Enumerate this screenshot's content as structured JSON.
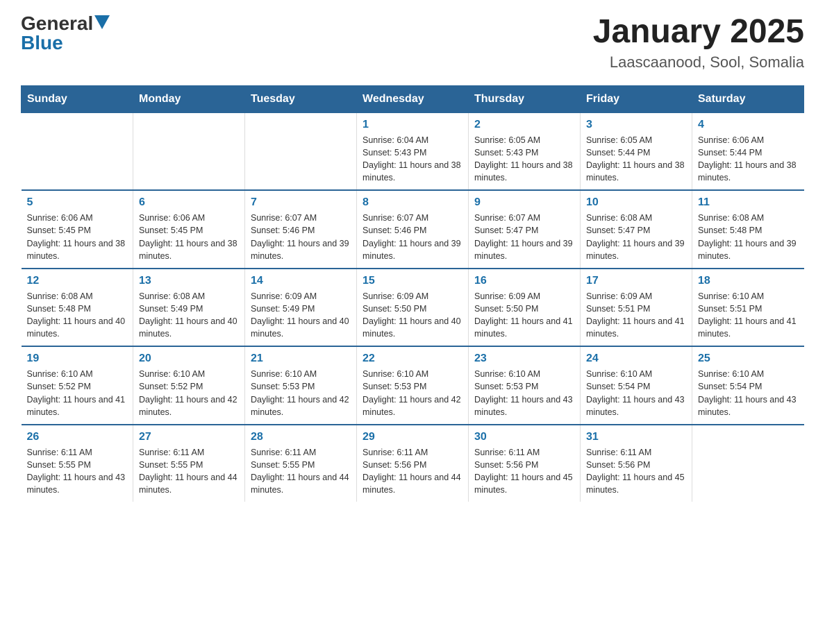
{
  "header": {
    "logo_general": "General",
    "logo_blue": "Blue",
    "month_title": "January 2025",
    "location": "Laascaanood, Sool, Somalia"
  },
  "days_of_week": [
    "Sunday",
    "Monday",
    "Tuesday",
    "Wednesday",
    "Thursday",
    "Friday",
    "Saturday"
  ],
  "weeks": [
    {
      "days": [
        {
          "number": "",
          "info": ""
        },
        {
          "number": "",
          "info": ""
        },
        {
          "number": "",
          "info": ""
        },
        {
          "number": "1",
          "info": "Sunrise: 6:04 AM\nSunset: 5:43 PM\nDaylight: 11 hours and 38 minutes."
        },
        {
          "number": "2",
          "info": "Sunrise: 6:05 AM\nSunset: 5:43 PM\nDaylight: 11 hours and 38 minutes."
        },
        {
          "number": "3",
          "info": "Sunrise: 6:05 AM\nSunset: 5:44 PM\nDaylight: 11 hours and 38 minutes."
        },
        {
          "number": "4",
          "info": "Sunrise: 6:06 AM\nSunset: 5:44 PM\nDaylight: 11 hours and 38 minutes."
        }
      ]
    },
    {
      "days": [
        {
          "number": "5",
          "info": "Sunrise: 6:06 AM\nSunset: 5:45 PM\nDaylight: 11 hours and 38 minutes."
        },
        {
          "number": "6",
          "info": "Sunrise: 6:06 AM\nSunset: 5:45 PM\nDaylight: 11 hours and 38 minutes."
        },
        {
          "number": "7",
          "info": "Sunrise: 6:07 AM\nSunset: 5:46 PM\nDaylight: 11 hours and 39 minutes."
        },
        {
          "number": "8",
          "info": "Sunrise: 6:07 AM\nSunset: 5:46 PM\nDaylight: 11 hours and 39 minutes."
        },
        {
          "number": "9",
          "info": "Sunrise: 6:07 AM\nSunset: 5:47 PM\nDaylight: 11 hours and 39 minutes."
        },
        {
          "number": "10",
          "info": "Sunrise: 6:08 AM\nSunset: 5:47 PM\nDaylight: 11 hours and 39 minutes."
        },
        {
          "number": "11",
          "info": "Sunrise: 6:08 AM\nSunset: 5:48 PM\nDaylight: 11 hours and 39 minutes."
        }
      ]
    },
    {
      "days": [
        {
          "number": "12",
          "info": "Sunrise: 6:08 AM\nSunset: 5:48 PM\nDaylight: 11 hours and 40 minutes."
        },
        {
          "number": "13",
          "info": "Sunrise: 6:08 AM\nSunset: 5:49 PM\nDaylight: 11 hours and 40 minutes."
        },
        {
          "number": "14",
          "info": "Sunrise: 6:09 AM\nSunset: 5:49 PM\nDaylight: 11 hours and 40 minutes."
        },
        {
          "number": "15",
          "info": "Sunrise: 6:09 AM\nSunset: 5:50 PM\nDaylight: 11 hours and 40 minutes."
        },
        {
          "number": "16",
          "info": "Sunrise: 6:09 AM\nSunset: 5:50 PM\nDaylight: 11 hours and 41 minutes."
        },
        {
          "number": "17",
          "info": "Sunrise: 6:09 AM\nSunset: 5:51 PM\nDaylight: 11 hours and 41 minutes."
        },
        {
          "number": "18",
          "info": "Sunrise: 6:10 AM\nSunset: 5:51 PM\nDaylight: 11 hours and 41 minutes."
        }
      ]
    },
    {
      "days": [
        {
          "number": "19",
          "info": "Sunrise: 6:10 AM\nSunset: 5:52 PM\nDaylight: 11 hours and 41 minutes."
        },
        {
          "number": "20",
          "info": "Sunrise: 6:10 AM\nSunset: 5:52 PM\nDaylight: 11 hours and 42 minutes."
        },
        {
          "number": "21",
          "info": "Sunrise: 6:10 AM\nSunset: 5:53 PM\nDaylight: 11 hours and 42 minutes."
        },
        {
          "number": "22",
          "info": "Sunrise: 6:10 AM\nSunset: 5:53 PM\nDaylight: 11 hours and 42 minutes."
        },
        {
          "number": "23",
          "info": "Sunrise: 6:10 AM\nSunset: 5:53 PM\nDaylight: 11 hours and 43 minutes."
        },
        {
          "number": "24",
          "info": "Sunrise: 6:10 AM\nSunset: 5:54 PM\nDaylight: 11 hours and 43 minutes."
        },
        {
          "number": "25",
          "info": "Sunrise: 6:10 AM\nSunset: 5:54 PM\nDaylight: 11 hours and 43 minutes."
        }
      ]
    },
    {
      "days": [
        {
          "number": "26",
          "info": "Sunrise: 6:11 AM\nSunset: 5:55 PM\nDaylight: 11 hours and 43 minutes."
        },
        {
          "number": "27",
          "info": "Sunrise: 6:11 AM\nSunset: 5:55 PM\nDaylight: 11 hours and 44 minutes."
        },
        {
          "number": "28",
          "info": "Sunrise: 6:11 AM\nSunset: 5:55 PM\nDaylight: 11 hours and 44 minutes."
        },
        {
          "number": "29",
          "info": "Sunrise: 6:11 AM\nSunset: 5:56 PM\nDaylight: 11 hours and 44 minutes."
        },
        {
          "number": "30",
          "info": "Sunrise: 6:11 AM\nSunset: 5:56 PM\nDaylight: 11 hours and 45 minutes."
        },
        {
          "number": "31",
          "info": "Sunrise: 6:11 AM\nSunset: 5:56 PM\nDaylight: 11 hours and 45 minutes."
        },
        {
          "number": "",
          "info": ""
        }
      ]
    }
  ]
}
